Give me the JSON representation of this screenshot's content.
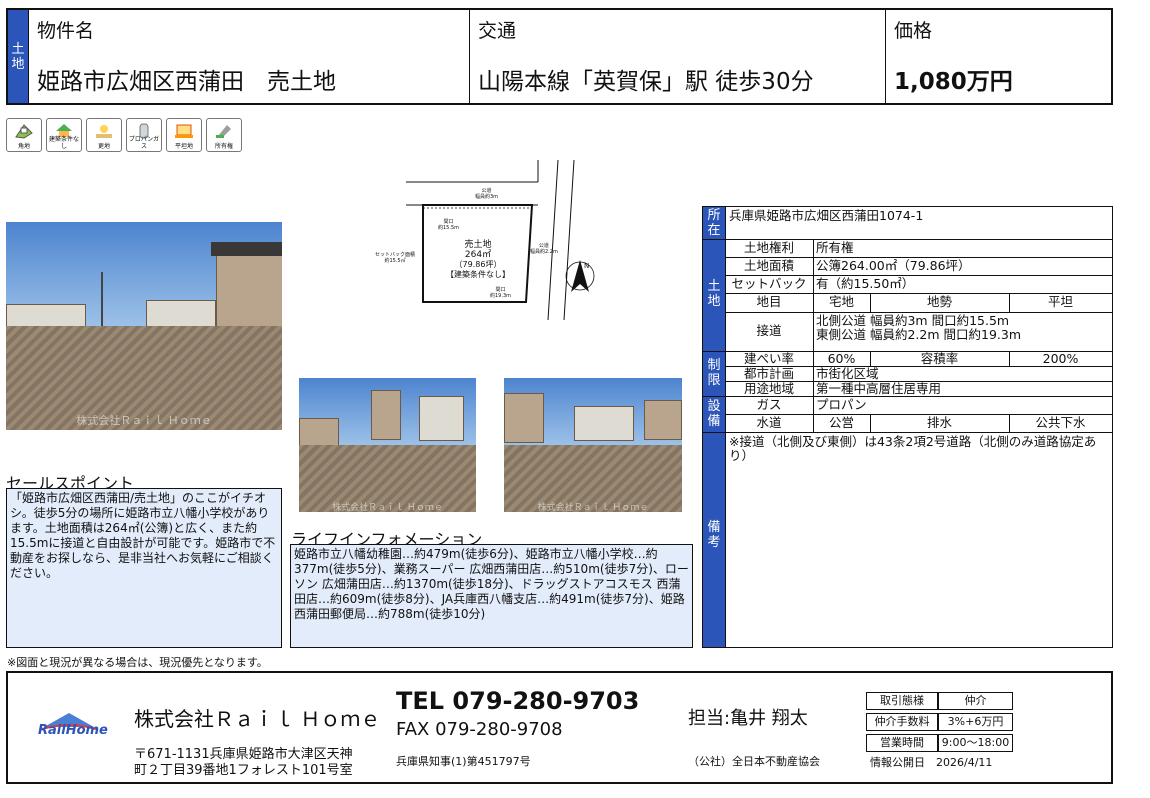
{
  "header": {
    "side_label": "土地",
    "name_label": "物件名",
    "name_value": "姫路市広畑区西蒲田　売土地",
    "access_label": "交通",
    "access_value": "山陽本線「英賀保」駅 徒歩30分",
    "price_label": "価格",
    "price_value": "1,080万円"
  },
  "icons": [
    {
      "name": "corner-lot-icon",
      "label": "角地"
    },
    {
      "name": "no-building-condition-icon",
      "label": "建築条件なし"
    },
    {
      "name": "vacant-lot-icon",
      "label": "更地"
    },
    {
      "name": "propane-gas-icon",
      "label": "プロパンガス"
    },
    {
      "name": "flat-land-icon",
      "label": "平坦地"
    },
    {
      "name": "ownership-icon",
      "label": "所有権"
    }
  ],
  "site_plan": {
    "road_north": "公道\n幅員約3m",
    "frontage_north": "間口\n約15.5m",
    "setback": "セットバック面積\n約15.5㎡",
    "lot_title": "売土地",
    "lot_area": "264㎡",
    "lot_tsubo": "（79.86坪）",
    "lot_condition": "【建築条件なし】",
    "road_east": "公道\n幅員約2.2m",
    "frontage_east": "間口\n約19.3m",
    "north": "N"
  },
  "watermark": "株式会社Ｒａｉｌ Ｈｏｍｅ",
  "sales_point": {
    "title": "セールスポイント",
    "text": "「姫路市広畑区西蒲田/売土地」のここがイチオシ。徒歩5分の場所に姫路市立八幡小学校があります。土地面積は264㎡(公簿)と広く、また約15.5mに接道と自由設計が可能です。姫路市で不動産をお探しなら、是非当社へお気軽にご相談ください。"
  },
  "life_info": {
    "title": "ライフインフォメーション",
    "text": "姫路市立八幡幼稚園…約479m(徒歩6分)、姫路市立八幡小学校…約377m(徒歩5分)、業務スーパー 広畑西蒲田店…約510m(徒歩7分)、ローソン 広畑蒲田店…約1370m(徒歩18分)、ドラッグストアコスモス 西蒲田店…約609m(徒歩8分)、JA兵庫西八幡支店…約491m(徒歩7分)、姫路西蒲田郵便局…約788m(徒歩10分)"
  },
  "table": {
    "location_side": "所在",
    "location_value": "兵庫県姫路市広畑区西蒲田1074-1",
    "land_side": "土地",
    "rights_label": "土地権利",
    "rights_value": "所有権",
    "area_label": "土地面積",
    "area_value": "公簿264.00㎡（79.86坪）",
    "setback_label": "セットバック",
    "setback_value": "有（約15.50㎡）",
    "category_label": "地目",
    "category_value": "宅地",
    "terrain_label": "地勢",
    "terrain_value": "平坦",
    "road_label": "接道",
    "road_value_1": "北側公道 幅員約3m 間口約15.5m",
    "road_value_2": "東側公道 幅員約2.2m 間口約19.3m",
    "restrict_side": "制限",
    "bcr_label": "建ぺい率",
    "bcr_value": "60%",
    "far_label": "容積率",
    "far_value": "200%",
    "plan_label": "都市計画",
    "plan_value": "市街化区域",
    "zone_label": "用途地域",
    "zone_value": "第一種中高層住居専用",
    "facility_side": "設備",
    "gas_label": "ガス",
    "gas_value": "プロパン",
    "water_label": "水道",
    "water_value": "公営",
    "drain_label": "排水",
    "drain_value": "公共下水",
    "remarks_side": "備考",
    "remarks_value": "※接道（北側及び東側）は43条2項2号道路（北側のみ道路協定あり）"
  },
  "note": "※図面と現況が異なる場合は、現況優先となります。",
  "footer": {
    "logo_text": "RailHome",
    "company": "株式会社Ｒａｉｌ Ｈｏｍｅ",
    "address_1": "〒671-1131兵庫県姫路市大津区天神",
    "address_2": "町２丁目39番地1フォレスト101号室",
    "tel": "TEL 079-280-9703",
    "fax": "FAX 079-280-9708",
    "license": "兵庫県知事(1)第451797号",
    "staff": "担当:亀井 翔太",
    "association": "（公社）全日本不動産協会",
    "deal_label": "取引態様",
    "deal_value": "仲介",
    "fee_label": "仲介手数料",
    "fee_value": "3%+6万円",
    "hours_label": "営業時間",
    "hours_value": "9:00～18:00",
    "published": "情報公開日　2026/4/11"
  },
  "colors": {
    "accent": "#2b55b8",
    "box_bg": "#e3ecfb"
  }
}
